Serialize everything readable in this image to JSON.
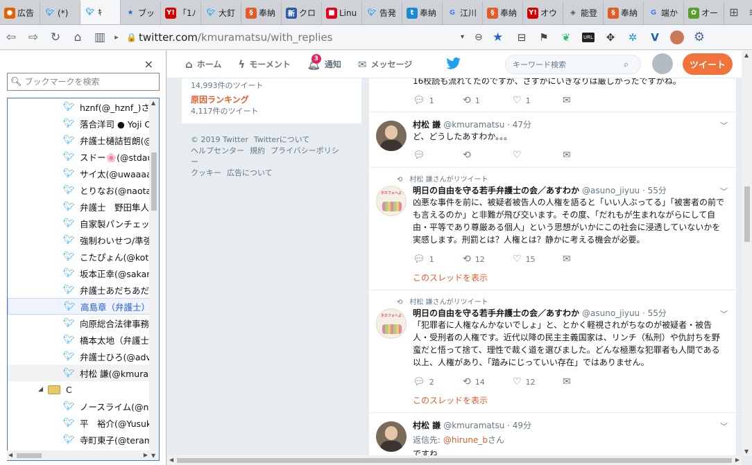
{
  "browser": {
    "tabs": [
      {
        "label": "広告",
        "icon": "firefox",
        "color": "#e66000"
      },
      {
        "label": "(*)",
        "icon": "twitter",
        "color": "#1da1f2"
      },
      {
        "label": "ｷ",
        "icon": "twitter",
        "color": "#1da1f2",
        "active": true
      },
      {
        "label": "ブッ",
        "icon": "bookmark-star",
        "color": "#2a62d6"
      },
      {
        "label": "「1ﾉ",
        "icon": "yahoo",
        "color": "#d50000"
      },
      {
        "label": "大釘",
        "icon": "twitter",
        "color": "#1da1f2"
      },
      {
        "label": "奉納",
        "icon": "site-orange",
        "color": "#e25c29"
      },
      {
        "label": "クロ",
        "icon": "news",
        "color": "#2f5aa8"
      },
      {
        "label": "Linu",
        "icon": "site-red",
        "color": "#e2001a"
      },
      {
        "label": "告発",
        "icon": "twitter",
        "color": "#1da1f2"
      },
      {
        "label": "奉納",
        "icon": "site-blue",
        "color": "#1b8ad3"
      },
      {
        "label": "江川",
        "icon": "google",
        "color": "#4285f4"
      },
      {
        "label": "奉納",
        "icon": "site-orange",
        "color": "#e25c29"
      },
      {
        "label": "オウ",
        "icon": "yahoo",
        "color": "#d50000"
      },
      {
        "label": "能登",
        "icon": "cube",
        "color": "#555555"
      },
      {
        "label": "奉納",
        "icon": "site-orange",
        "color": "#e25c29"
      },
      {
        "label": "端か",
        "icon": "google",
        "color": "#4285f4"
      },
      {
        "label": "オー",
        "icon": "site-green",
        "color": "#5a9e2f"
      }
    ],
    "url_host": "twitter.com",
    "url_path": "/kmuramatsu/with_replies"
  },
  "sidebar": {
    "search_placeholder": "ブックマークを検索",
    "close": "×",
    "items": [
      {
        "label": "hznf(@_hznf_)さん"
      },
      {
        "label": "落合洋司 ● Yoji O"
      },
      {
        "label": "弁護士樋詰哲朗(@"
      },
      {
        "label": "スドー🌸(@stdau"
      },
      {
        "label": "サイ太(@uwaaaa)"
      },
      {
        "label": "とりなお(@naotar"
      },
      {
        "label": "弁護士　野田隼人"
      },
      {
        "label": "自家製パンチェッタ"
      },
      {
        "label": "強制わいせつ/準強"
      },
      {
        "label": "こたぴょん(@kotac"
      },
      {
        "label": "坂本正幸(@sakan"
      },
      {
        "label": "弁護士あだちあだ"
      },
      {
        "label": "高島章（弁護士）(@",
        "selected": true
      },
      {
        "label": "向原総合法律事務"
      },
      {
        "label": "橋本太地（弁護士"
      },
      {
        "label": "弁護士ひろ(@adv"
      },
      {
        "label": "村松 謙(@kmuran",
        "hover": true
      }
    ],
    "folder": {
      "label": "C"
    },
    "folder_items": [
      {
        "label": "ノースライム(@noc"
      },
      {
        "label": "平　裕介(@Yusuk"
      },
      {
        "label": "寺町東子(@teram"
      }
    ]
  },
  "twitter": {
    "nav": {
      "home": "ホーム",
      "moments": "モーメント",
      "notifications": "通知",
      "notifications_badge": "3",
      "messages": "メッセージ"
    },
    "search_placeholder": "キーワード検索",
    "tweet_button": "ツイート",
    "trends": {
      "top_count": "14,993件のツイート",
      "name": "原因ランキング",
      "count": "4,117件のツイート"
    },
    "footer": {
      "links": [
        "© 2019 Twitter",
        "Twitterについて",
        "ヘルプセンター",
        "規約",
        "プライバシーポリシー",
        "クッキー",
        "広告について"
      ]
    },
    "timeline": {
      "partial_top": {
        "text": "16校読も流れてたのですが、さすがにいきなりは厳しかったですかね。",
        "replies": "1",
        "retweets": "1",
        "likes": "1"
      },
      "tweets": [
        {
          "name": "村松 謙",
          "handle": "@kmuramatsu",
          "time": "· 47分",
          "text": "ど、どうしたあすわか。。。",
          "replies": "",
          "retweets": "",
          "likes": ""
        },
        {
          "retweet_by": "村松 謙さんがリツイート",
          "name": "明日の自由を守る若手弁護士の会／あすわか",
          "handle": "@asuno_jiyuu",
          "time": "· 55分",
          "text": "凶悪な事件を前に、被疑者被告人の人権を語ると「いい人ぶってる」「被害者の前でも言えるのか」と非難が飛び交います。その度、「だれもが生まれながらにして自由・平等であり尊厳ある個人」という思想がいかにこの社会に浸透していないかを実感します。刑罰とは？人権とは？静かに考える機会が必要。",
          "replies": "1",
          "retweets": "12",
          "likes": "15",
          "thread_link": "このスレッドを表示"
        },
        {
          "retweet_by": "村松 謙さんがリツイート",
          "name": "明日の自由を守る若手弁護士の会／あすわか",
          "handle": "@asuno_jiyuu",
          "time": "· 55分",
          "text": "「犯罪者に人権なんかないでしょ」と、とかく軽視されがちなのが被疑者・被告人・受刑者の人権です。近代以降の民主主義国家は、リンチ（私刑）や仇討ちを野蛮だと悟って捨て、理性で裁く道を選びました。どんな極悪な犯罪者も人間である以上、人権があり、「踏みにじっていい存在」ではありません。",
          "replies": "2",
          "retweets": "14",
          "likes": "12",
          "thread_link": "このスレッドを表示"
        },
        {
          "name": "村松 謙",
          "handle": "@kmuramatsu",
          "time": "· 49分",
          "reply_prefix": "返信先: ",
          "reply_to": "@hirune_b",
          "reply_suffix": "さん",
          "text": "ですね"
        }
      ],
      "avatar_label": "ホカフェへようこそ"
    }
  }
}
